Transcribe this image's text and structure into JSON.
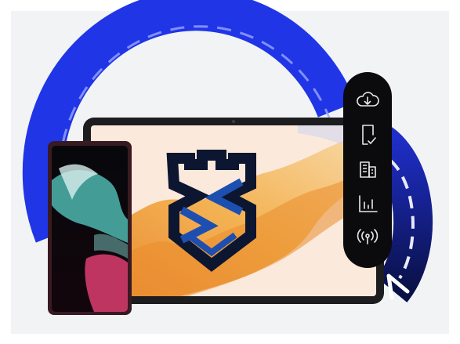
{
  "colors": {
    "background": "#ffffff",
    "panel": "#f2f3f5",
    "ring_blue": "#2035e6",
    "ring_dark": "#0c1450",
    "device_frame": "#1d1d20",
    "icon_panel": "#0b0b0d",
    "icon_stroke": "#e8e8e8",
    "shield_dark": "#0d1630",
    "shield_blue": "#1d4fb0",
    "tablet_screen": "#fbe9dc",
    "flame_orange": "#f0a23a",
    "phone_teal": "#4fb6b0",
    "phone_pink": "#d23b6a"
  },
  "icons": [
    "cloud-download-icon",
    "device-check-icon",
    "office-building-icon",
    "bar-chart-icon",
    "wireless-signal-icon"
  ]
}
